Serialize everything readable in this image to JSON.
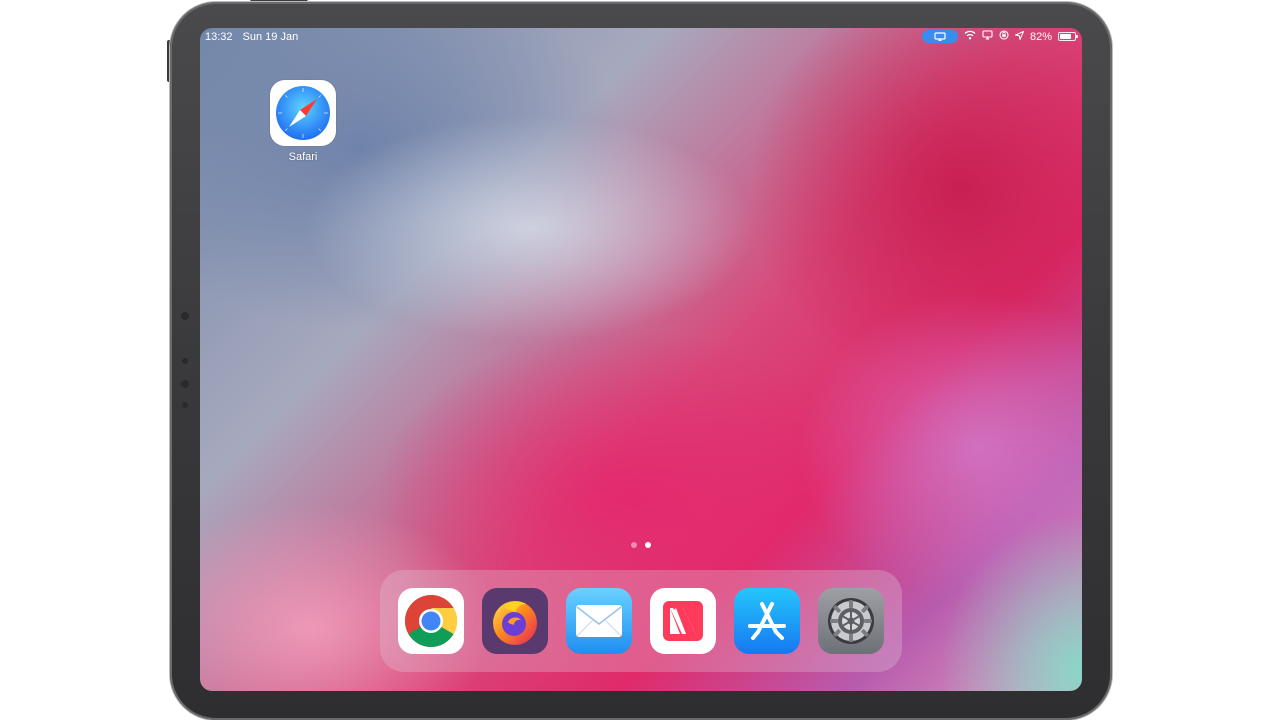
{
  "status_bar": {
    "time": "13:32",
    "date": "Sun 19 Jan",
    "battery_percent": "82%",
    "battery_level": 0.82,
    "icons": [
      "screen-mirroring-icon",
      "wifi-icon",
      "airplay-icon",
      "orientation-lock-icon",
      "location-icon",
      "battery-icon"
    ]
  },
  "home_screen": {
    "apps": [
      {
        "label": "Safari",
        "icon": "safari-icon"
      }
    ],
    "page_dots": {
      "count": 2,
      "active_index": 1
    }
  },
  "dock": {
    "apps": [
      {
        "icon": "chrome-icon"
      },
      {
        "icon": "firefox-icon"
      },
      {
        "icon": "mail-icon"
      },
      {
        "icon": "news-icon"
      },
      {
        "icon": "app-store-icon"
      },
      {
        "icon": "settings-icon"
      }
    ]
  },
  "colors": {
    "airplay_pill": "#3b8cf0",
    "bezel": "#3a3a3c",
    "wallpaper_primary": "#e02a6a"
  }
}
